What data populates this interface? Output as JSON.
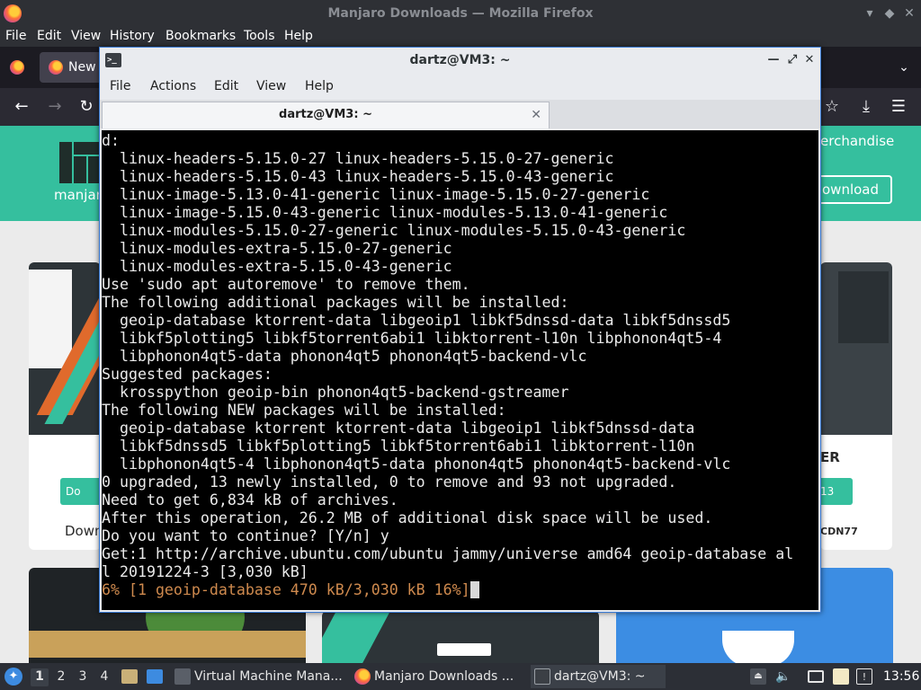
{
  "firefox": {
    "window_title": "Manjaro Downloads — Mozilla Firefox",
    "menu": [
      "File",
      "Edit",
      "View",
      "History",
      "Bookmarks",
      "Tools",
      "Help"
    ],
    "tab_label": "New",
    "page": {
      "logo_text": "manjaro",
      "merch_text": "erchandise",
      "download_button": "ownload",
      "left_card_button": "Do",
      "left_card_label": "Down",
      "right_card_title": "ER",
      "right_card_button": "13",
      "right_card_cdn": "CDN77"
    }
  },
  "terminal": {
    "title": "dartz@VM3: ~",
    "menu": [
      "File",
      "Actions",
      "Edit",
      "View",
      "Help"
    ],
    "tab_title": "dartz@VM3: ~",
    "lines": [
      "d:",
      "  linux-headers-5.15.0-27 linux-headers-5.15.0-27-generic",
      "  linux-headers-5.15.0-43 linux-headers-5.15.0-43-generic",
      "  linux-image-5.13.0-41-generic linux-image-5.15.0-27-generic",
      "  linux-image-5.15.0-43-generic linux-modules-5.13.0-41-generic",
      "  linux-modules-5.15.0-27-generic linux-modules-5.15.0-43-generic",
      "  linux-modules-extra-5.15.0-27-generic",
      "  linux-modules-extra-5.15.0-43-generic",
      "Use 'sudo apt autoremove' to remove them.",
      "The following additional packages will be installed:",
      "  geoip-database ktorrent-data libgeoip1 libkf5dnssd-data libkf5dnssd5",
      "  libkf5plotting5 libkf5torrent6abi1 libktorrent-l10n libphonon4qt5-4",
      "  libphonon4qt5-data phonon4qt5 phonon4qt5-backend-vlc",
      "Suggested packages:",
      "  krosspython geoip-bin phonon4qt5-backend-gstreamer",
      "The following NEW packages will be installed:",
      "  geoip-database ktorrent ktorrent-data libgeoip1 libkf5dnssd-data",
      "  libkf5dnssd5 libkf5plotting5 libkf5torrent6abi1 libktorrent-l10n",
      "  libphonon4qt5-4 libphonon4qt5-data phonon4qt5 phonon4qt5-backend-vlc",
      "0 upgraded, 13 newly installed, 0 to remove and 93 not upgraded.",
      "Need to get 6,834 kB of archives.",
      "After this operation, 26.2 MB of additional disk space will be used.",
      "Do you want to continue? [Y/n] y",
      "Get:1 http://archive.ubuntu.com/ubuntu jammy/universe amd64 geoip-database al",
      "l 20191224-3 [3,030 kB]"
    ],
    "progress_line": "6% [1 geoip-database 470 kB/3,030 kB 16%]"
  },
  "taskbar": {
    "workspaces": [
      "1",
      "2",
      "3",
      "4"
    ],
    "tasks": [
      {
        "label": "Virtual Machine Mana..."
      },
      {
        "label": "Manjaro Downloads ..."
      },
      {
        "label": "dartz@VM3: ~"
      }
    ],
    "clock": "13:56"
  },
  "colors": {
    "manjaro_green": "#35bf9e",
    "terminal_bg": "#000000",
    "terminal_fg": "#eaeaea",
    "progress_fg": "#cf8a4e",
    "window_accent": "#3a7bd5"
  }
}
